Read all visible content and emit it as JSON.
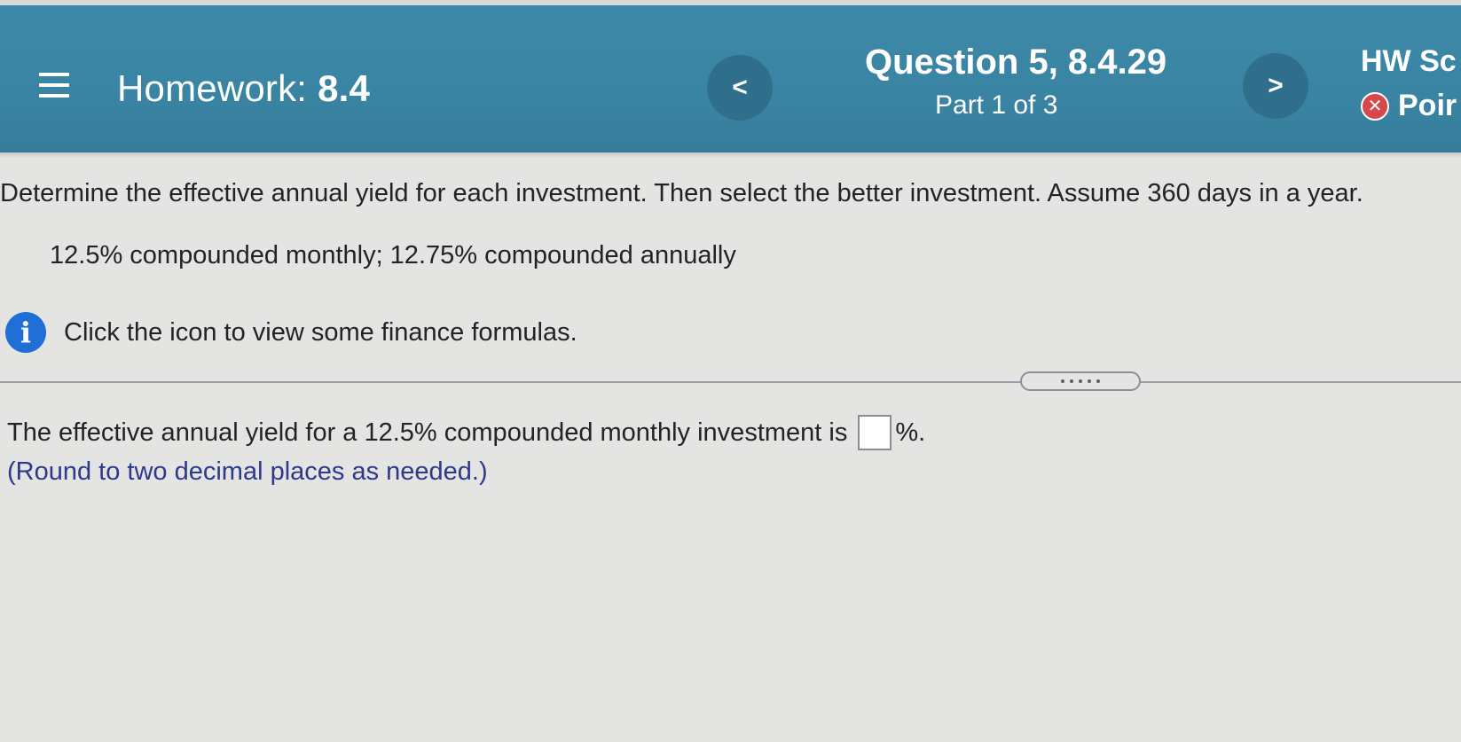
{
  "header": {
    "menu_icon": "hamburger-menu-icon",
    "homework_label": "Homework:",
    "homework_number": "8.4",
    "prev_label": "<",
    "question_title": "Question 5, 8.4.29",
    "question_part": "Part 1 of 3",
    "next_label": ">",
    "hw_score_label": "HW Sc",
    "points_label": "Poir",
    "points_icon": "x-circle-icon",
    "colors": {
      "header_bg": "#3a84a3",
      "nav_button_bg": "#2f6f8c",
      "points_icon_bg": "#d8484b"
    }
  },
  "question": {
    "prompt": "Determine the effective annual yield for each investment. Then select the better investment. Assume 360 days in a year.",
    "given": "12.5% compounded monthly; 12.75% compounded annually",
    "info_icon": "info-icon",
    "info_text": "Click the icon to view some finance formulas."
  },
  "answer": {
    "text_before": "The effective annual yield for a 12.5% compounded monthly investment is",
    "input_value": "",
    "text_after": "%.",
    "note": "(Round to two decimal places as needed.)",
    "note_color": "#2c3a8a"
  },
  "page": {
    "background": "#e4e4e2",
    "info_icon_color": "#1f6fd6"
  }
}
